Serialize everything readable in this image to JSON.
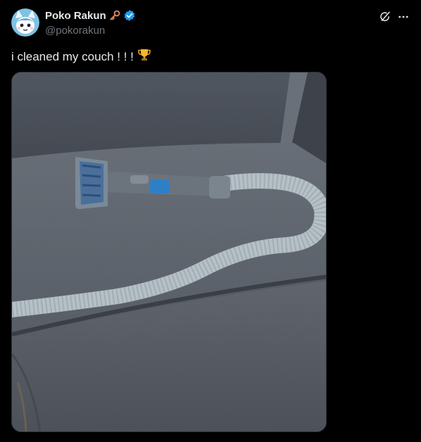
{
  "author": {
    "display_name": "Poko Rakun",
    "handle": "@pokorakun",
    "badge_icon": "key-icon",
    "verified_icon": "verified-badge-icon",
    "verified_color": "#1d9bf0"
  },
  "post": {
    "text": "i cleaned my couch ! ! !",
    "emoji_icon": "trophy-icon"
  },
  "actions": {
    "grok_icon": "grok-icon",
    "more_icon": "more-icon"
  },
  "colors": {
    "background": "#000000",
    "text_primary": "#e7e9ea",
    "text_secondary": "#71767b"
  }
}
